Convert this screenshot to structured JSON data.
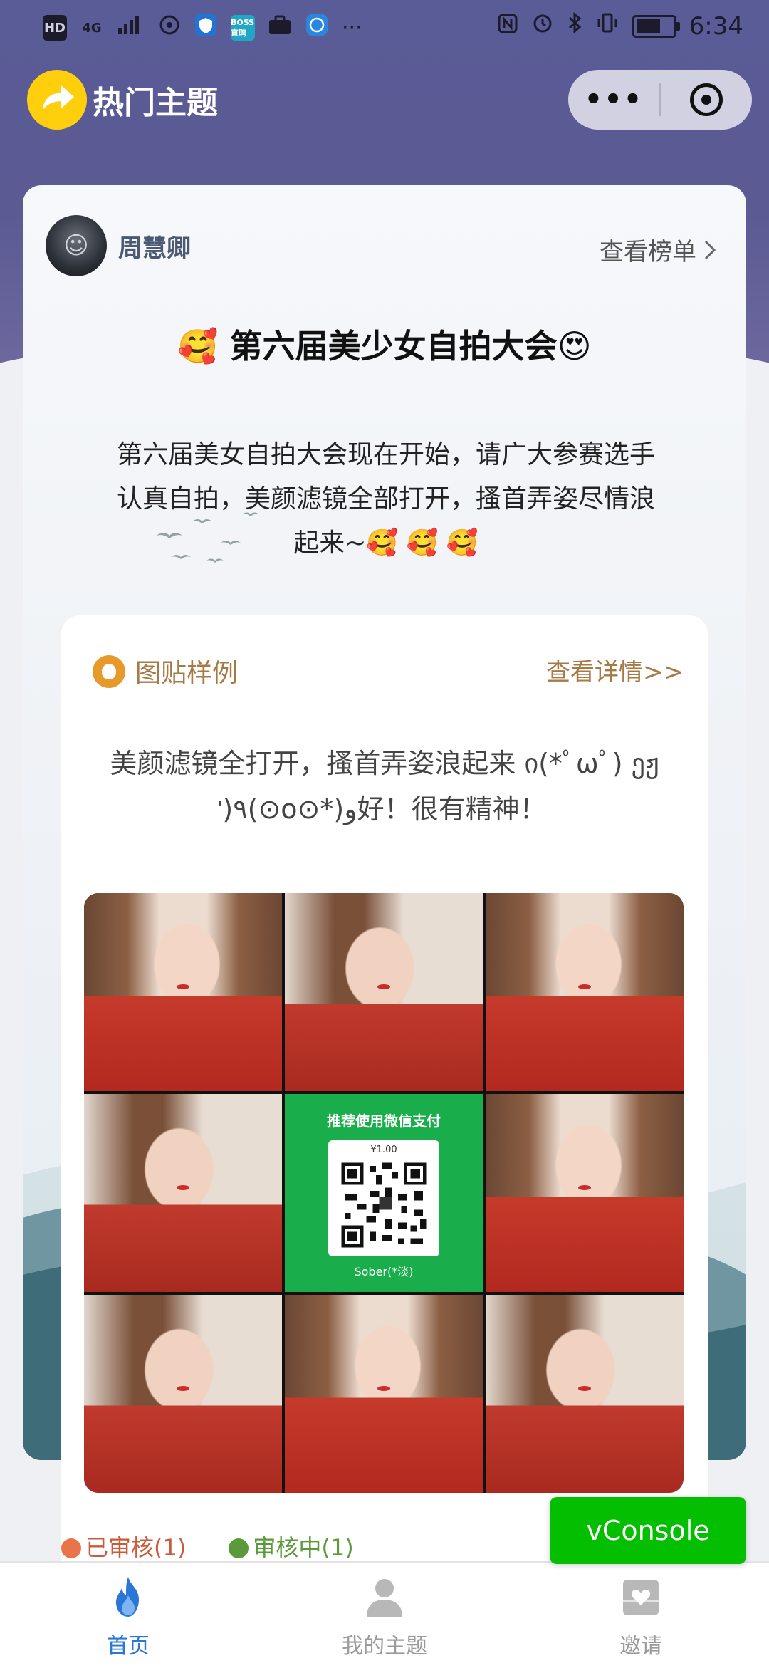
{
  "status_bar": {
    "left_chips": [
      "HD",
      "4G",
      "BOSS直聘"
    ],
    "time": "6:34",
    "more": "···"
  },
  "header": {
    "title": "热门主题",
    "capsule_more": "•••"
  },
  "card": {
    "author_name": "周慧卿",
    "rank_link": "查看榜单",
    "event_title": "🥰 第六届美少女自拍大会😍",
    "event_desc": "第六届美女自拍大会现在开始，请广大参赛选手认真自拍，美颜滤镜全部打开，搔首弄姿尽情浪起来~🥰 🥰 🥰"
  },
  "sample": {
    "label": "图贴样例",
    "detail_link": "查看详情>>",
    "text": "美颜滤镜全打开，搔首弄姿浪起来 ი(*ﾟωﾟ) ეჟ ᡃ)٩(⊙o⊙*)و好！很有精神！",
    "qr_title": "推荐使用微信支付",
    "qr_price": "¥1.00",
    "qr_name": "Sober(*淡)"
  },
  "tags": {
    "approved": "已审核(1)",
    "reviewing": "审核中(1)"
  },
  "vconsole": "vConsole",
  "tabbar": {
    "tabs": [
      {
        "label": "首页",
        "icon": "flame-icon",
        "active": true
      },
      {
        "label": "我的主题",
        "icon": "user-icon",
        "active": false
      },
      {
        "label": "邀请",
        "icon": "gift-heart-icon",
        "active": false
      }
    ]
  },
  "colors": {
    "header_purple": "#5a5c98",
    "accent_blue": "#2a77d8",
    "accent_gold": "#a57a45",
    "wechat_green": "#1aad4b",
    "vconsole_green": "#04be02"
  }
}
